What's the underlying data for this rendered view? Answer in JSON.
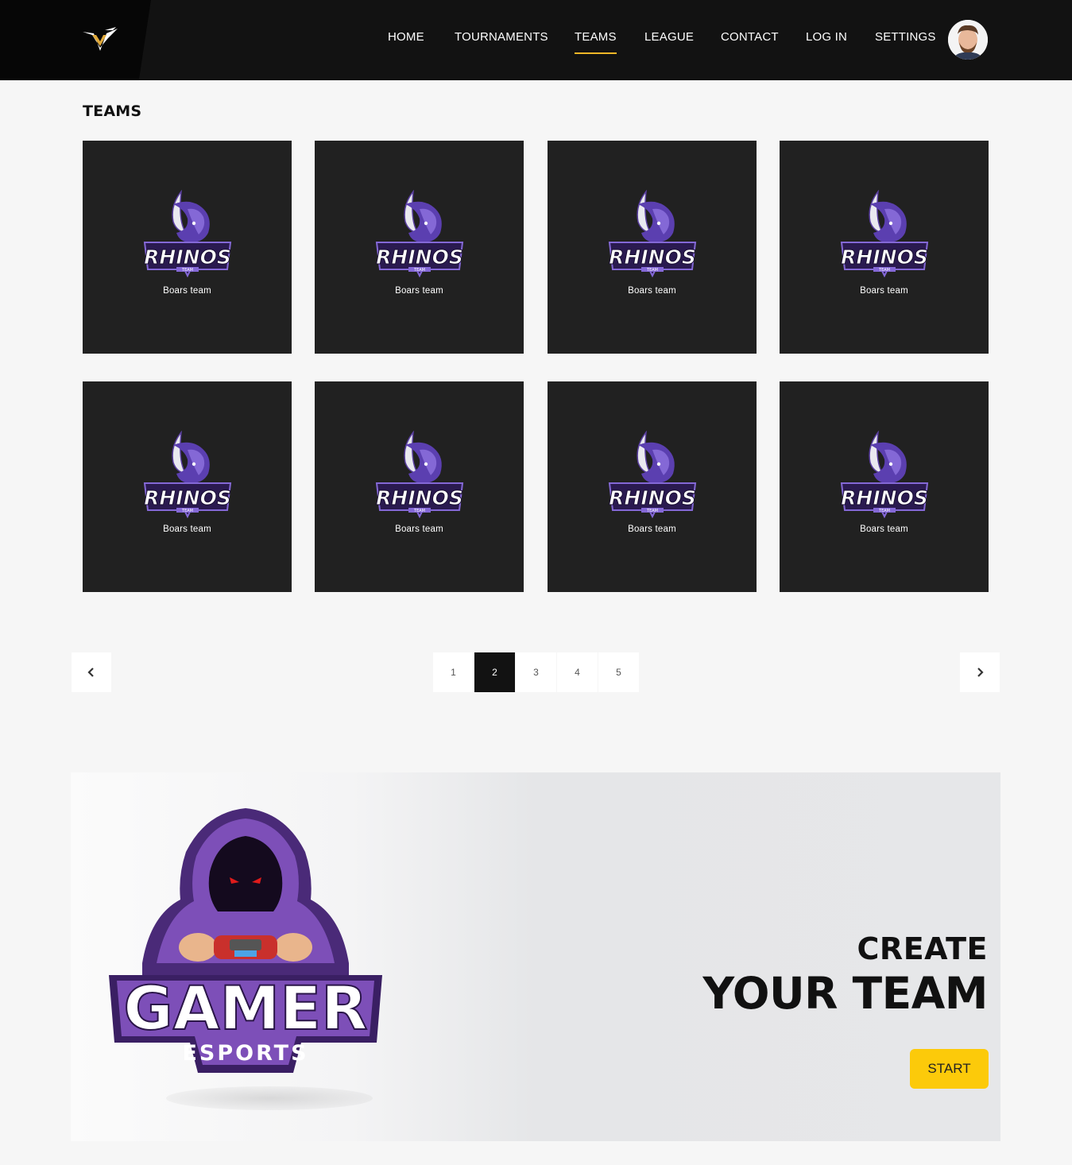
{
  "nav": {
    "items": [
      {
        "label": "HOME",
        "name": "nav-item-home"
      },
      {
        "label": "TOURNAMENTS",
        "name": "nav-item-tournaments"
      },
      {
        "label": "TEAMS",
        "name": "nav-item-teams",
        "active": true
      },
      {
        "label": "LEAGUE",
        "name": "nav-item-league"
      },
      {
        "label": "CONTACT",
        "name": "nav-item-contact"
      },
      {
        "label": "LOG IN",
        "name": "nav-item-login"
      },
      {
        "label": "SETTINGS",
        "name": "nav-item-settings"
      }
    ],
    "accent": "#f2b627"
  },
  "page": {
    "title": "TEAMS"
  },
  "teams": [
    {
      "emblem_text": "RHINOS",
      "emblem_sub": "TEAM",
      "name": "Boars team"
    },
    {
      "emblem_text": "RHINOS",
      "emblem_sub": "TEAM",
      "name": "Boars team"
    },
    {
      "emblem_text": "RHINOS",
      "emblem_sub": "TEAM",
      "name": "Boars team"
    },
    {
      "emblem_text": "RHINOS",
      "emblem_sub": "TEAM",
      "name": "Boars team"
    },
    {
      "emblem_text": "RHINOS",
      "emblem_sub": "TEAM",
      "name": "Boars team"
    },
    {
      "emblem_text": "RHINOS",
      "emblem_sub": "TEAM",
      "name": "Boars team"
    },
    {
      "emblem_text": "RHINOS",
      "emblem_sub": "TEAM",
      "name": "Boars team"
    },
    {
      "emblem_text": "RHINOS",
      "emblem_sub": "TEAM",
      "name": "Boars team"
    }
  ],
  "pagination": {
    "pages": [
      "1",
      "2",
      "3",
      "4",
      "5"
    ],
    "current": "2",
    "prev_icon": "chevron-left-icon",
    "next_icon": "chevron-right-icon"
  },
  "banner": {
    "logo_text": "GAMER",
    "logo_sub": "ESPORTS",
    "line1": "CREATE",
    "line2": "YOUR TEAM",
    "button": "START",
    "button_color": "#fcca0a"
  }
}
